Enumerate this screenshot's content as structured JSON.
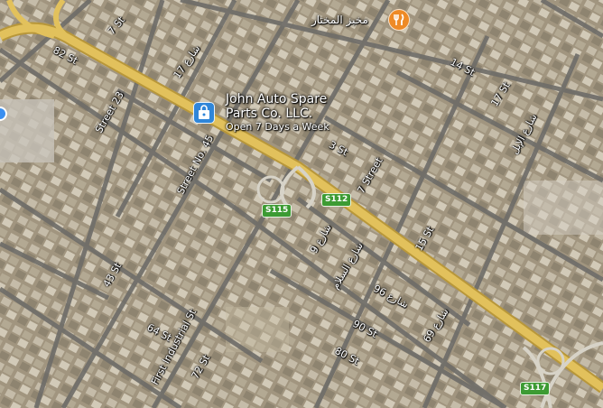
{
  "map": {
    "type": "satellite",
    "colors": {
      "highway": "#e2c15c",
      "street": "#6b6b6b",
      "label": "#ffffff",
      "shield": "#3c9b33",
      "poi_shop": "#2f86d9",
      "poi_food": "#ee8a26"
    }
  },
  "poi": {
    "shop": {
      "name_line1": "John Auto Spare",
      "name_line2": "Parts Co. LLC.",
      "status": "Open 7 Days a Week",
      "icon": "shopping-bag-icon"
    },
    "bakery": {
      "name": "مخبز المختار",
      "icon": "fork-knife-icon"
    }
  },
  "shields": [
    "S115",
    "S112",
    "S117"
  ],
  "streets": {
    "st7_top": "7 St",
    "st82": "82 St",
    "st17_ar": "شارع 17",
    "st14": "14 St",
    "st17": "17 St",
    "street23": "Street 23",
    "street_no45": "Street No. 45",
    "st3": "3 St",
    "st7_street": "7 Street",
    "st_alil": "شارع الإبل",
    "st9_ar": "شارع 9",
    "st_alsalam": "شارع السلام",
    "st15": "15 St",
    "st96_ar": "شارع 96",
    "st43": "43 St",
    "first_industrial": "First Industrial St",
    "st64": "64 St",
    "st90": "90 St",
    "st69_ar": "شارع 69",
    "st72": "72 St",
    "st80": "80 St"
  }
}
